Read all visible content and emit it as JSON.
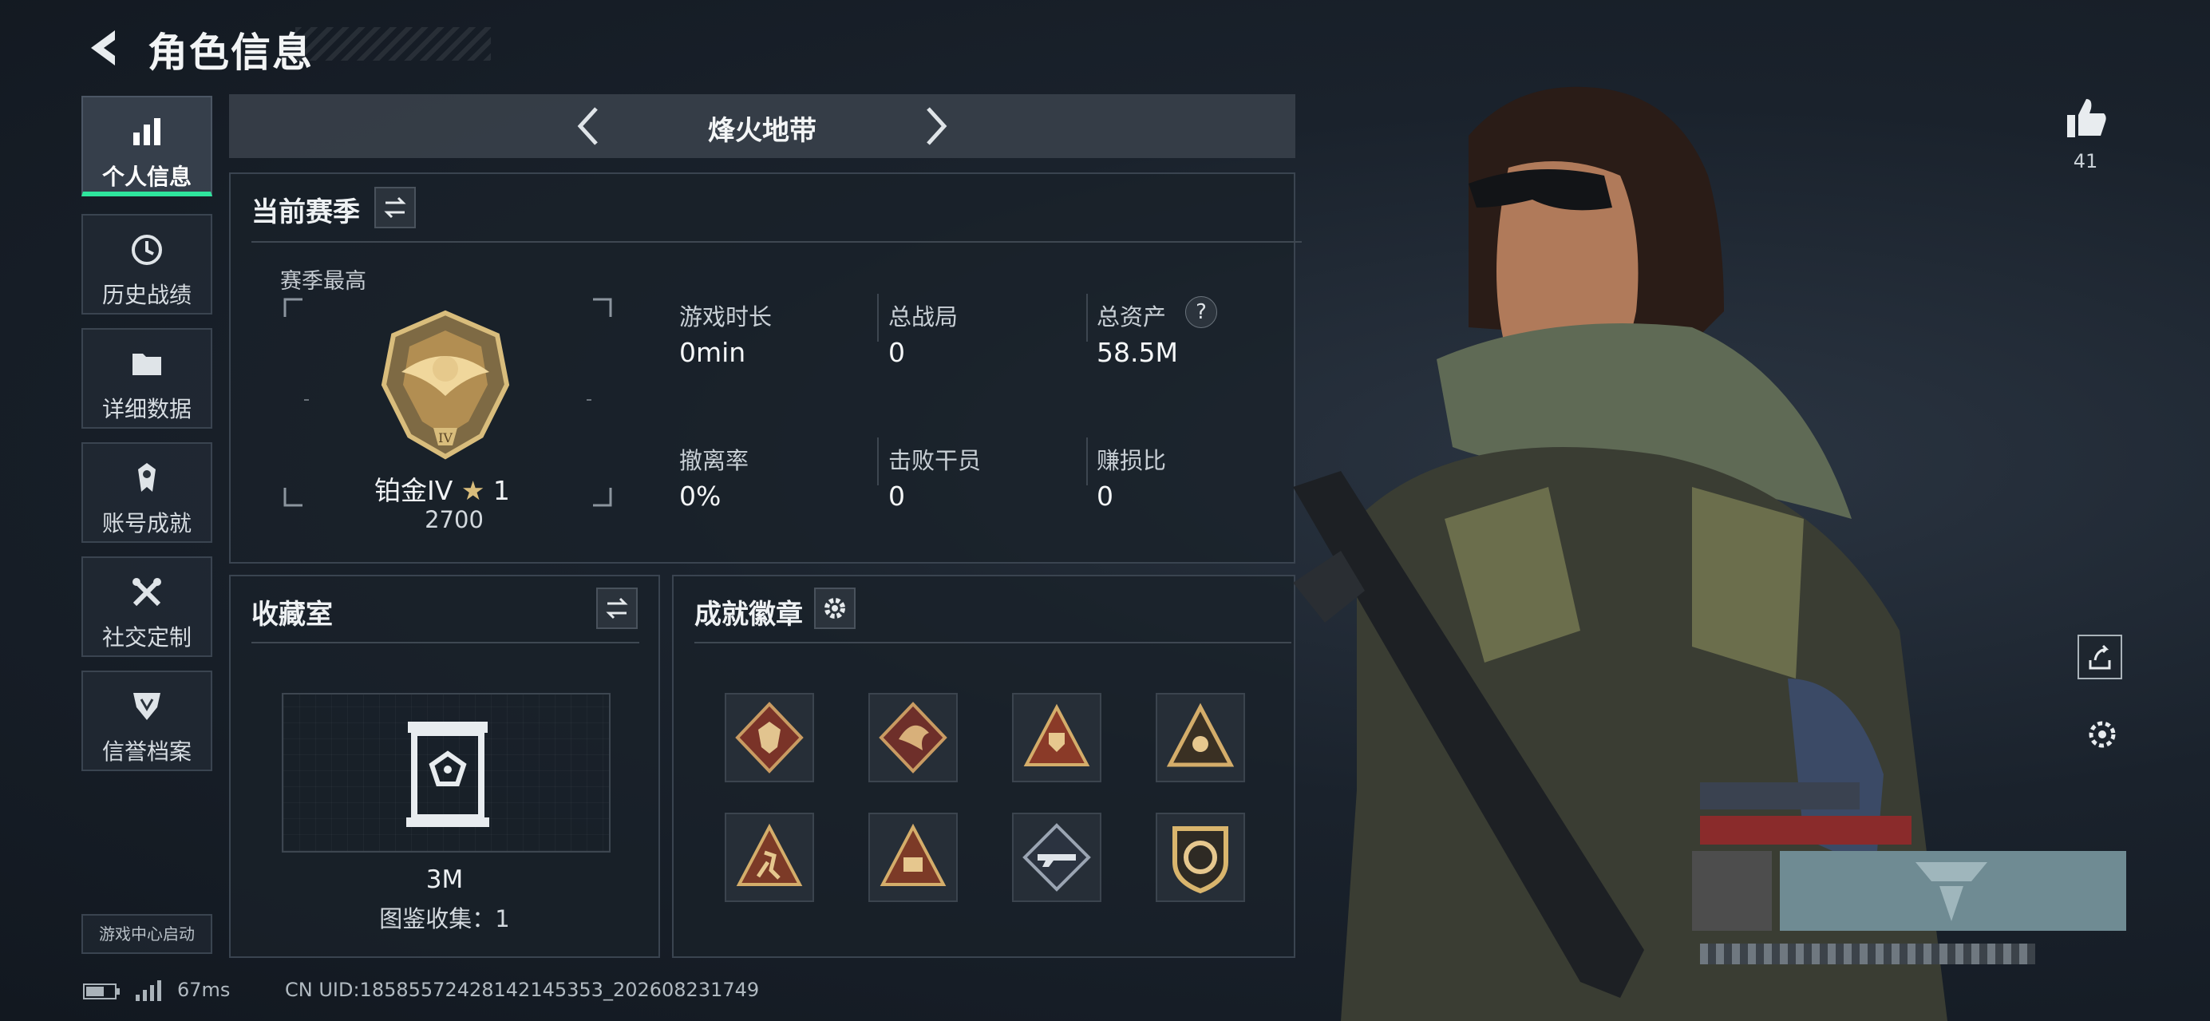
{
  "header": {
    "title": "角色信息"
  },
  "nav": {
    "items": [
      {
        "label": "个人信息",
        "icon": "bar-chart-icon",
        "active": true
      },
      {
        "label": "历史战绩",
        "icon": "clock-icon"
      },
      {
        "label": "详细数据",
        "icon": "folder-icon"
      },
      {
        "label": "账号成就",
        "icon": "medal-icon"
      },
      {
        "label": "社交定制",
        "icon": "tools-icon"
      },
      {
        "label": "信誉档案",
        "icon": "shield-icon"
      }
    ],
    "game_center": "游戏中心启动"
  },
  "map_selector": {
    "name": "烽火地带"
  },
  "season": {
    "title": "当前赛季",
    "best_label": "赛季最高",
    "rank_name": "铂金IV",
    "rank_stars": "1",
    "rank_points": "2700",
    "stats": [
      {
        "label": "游戏时长",
        "value": "0min"
      },
      {
        "label": "总战局",
        "value": "0"
      },
      {
        "label": "总资产",
        "value": "58.5M",
        "help": "?"
      },
      {
        "label": "撤离率",
        "value": "0%"
      },
      {
        "label": "击败干员",
        "value": "0"
      },
      {
        "label": "赚损比",
        "value": "0"
      }
    ]
  },
  "collection": {
    "title": "收藏室",
    "value": "3M",
    "catalog": "图鉴收集：1"
  },
  "achievements": {
    "title": "成就徽章",
    "badges": [
      "wolf-badge-icon",
      "dragon-badge-icon",
      "trophy-badge-icon",
      "eye-badge-icon",
      "runner-badge-icon",
      "level-50-badge-icon",
      "rifle-badge-icon",
      "gold-shield-badge-icon"
    ]
  },
  "status_bar": {
    "ping": "67ms",
    "uid": "CN UID:1858557242814214535​3_202608231749"
  },
  "likes": {
    "count": "41"
  },
  "colors": {
    "accent": "#2ee59d",
    "panel_border": "#3a4450",
    "gold": "#c9a45c"
  }
}
